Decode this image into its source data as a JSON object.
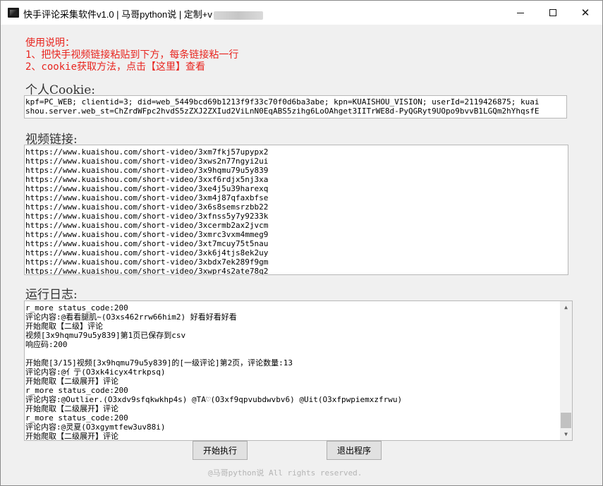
{
  "window": {
    "title": "快手评论采集软件v1.0 | 马哥python说 | 定制+v"
  },
  "instructions": {
    "line1": "使用说明：",
    "line2": "1、把快手视频链接粘贴到下方，每条链接粘一行",
    "line3": "2、cookie获取方法，点击【这里】查看"
  },
  "cookie": {
    "label": "个人Cookie:",
    "value_line1": "kpf=PC_WEB; clientid=3; did=web_5449bcd69b1213f9f33c70f0d6ba3abe; kpn=KUAISHOU_VISION; userId=2119426875; kuai",
    "value_line2": "shou.server.web_st=ChZrdWFpc2hvdS5zZXJ2ZXIud2ViLnN0EqABS5zihg6LoOAhget3IITrWE8d-PyQGRyt9UOpo9bvvB1LGQm2hYhqsfE"
  },
  "links": {
    "label": "视频链接:",
    "items": [
      "https://www.kuaishou.com/short-video/3xm7fkj57upypx2",
      "https://www.kuaishou.com/short-video/3xws2n77ngyi2ui",
      "https://www.kuaishou.com/short-video/3x9hqmu79u5y839",
      "https://www.kuaishou.com/short-video/3xxf6rdjx5nj3xa",
      "https://www.kuaishou.com/short-video/3xe4j5u39harexq",
      "https://www.kuaishou.com/short-video/3xm4j87qfaxbfse",
      "https://www.kuaishou.com/short-video/3x6s8semsrzbb22",
      "https://www.kuaishou.com/short-video/3xfnss5y7y9233k",
      "https://www.kuaishou.com/short-video/3xcermb2ax2jvcm",
      "https://www.kuaishou.com/short-video/3xmrc3vxm4mmeg9",
      "https://www.kuaishou.com/short-video/3xt7mcuy75t5nau",
      "https://www.kuaishou.com/short-video/3xk6j4tjs8ek2uy",
      "https://www.kuaishou.com/short-video/3xbdx7ek289f9gm",
      "https://www.kuaishou.com/short-video/3xwpr4s2ate78q2"
    ]
  },
  "log": {
    "label": "运行日志:",
    "lines": [
      "r_more status_code:200",
      "评论内容:@看看腿肌~(O3xs462rrw66him2) 好看好看好看",
      "开始爬取【二级】评论",
      "视频[3x9hqmu79u5y839]第1页已保存到csv",
      "响应码:200",
      "",
      "开始爬[3/15]视频[3x9hqmu79u5y839]的[一级评论]第2页，评论数量:13",
      "评论内容:@亻亍(O3xk4icyx4trkpsq)",
      "开始爬取【二级展开】评论",
      "r_more status_code:200",
      "评论内容:@Outlier.(O3xdv9sfqkwkhp4s) @TA♡(O3xf9qpvubdwvbv6) @Uit(O3xfpwpiemxzfrwu)",
      "开始爬取【二级展开】评论",
      "r_more status_code:200",
      "评论内容:@灵夏(O3xgymtfew3uv88i)",
      "开始爬取【二级展开】评论"
    ]
  },
  "buttons": {
    "start": "开始执行",
    "exit": "退出程序"
  },
  "footer": {
    "text": "@马哥python说 All rights reserved."
  }
}
